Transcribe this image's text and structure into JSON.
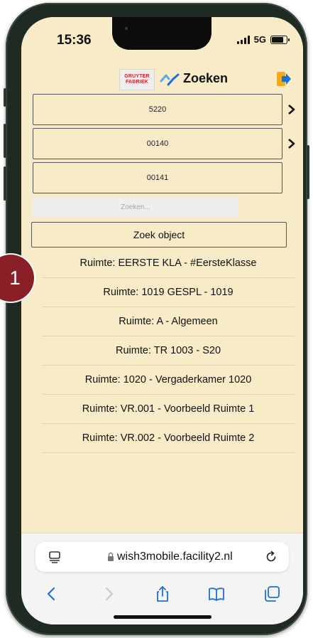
{
  "status_bar": {
    "time": "15:36",
    "network": "5G"
  },
  "header": {
    "brand_line1": "GRUYTER",
    "brand_line2": "FABRIEK",
    "title": "Zoeken"
  },
  "objects": [
    {
      "label": "5220",
      "has_children": true
    },
    {
      "label": "00140",
      "has_children": true
    },
    {
      "label": "00141",
      "has_children": false
    }
  ],
  "search": {
    "placeholder": "Zoeken...",
    "value": ""
  },
  "search_button": {
    "label": "Zoek object"
  },
  "results": [
    "Ruimte: EERSTE KLA - #EersteKlasse",
    "Ruimte: 1019 GESPL - 1019",
    "Ruimte: A - Algemeen",
    "Ruimte: TR 1003 - S20",
    "Ruimte: 1020 - Vergaderkamer 1020",
    "Ruimte: VR.001 - Voorbeeld Ruimte 1",
    "Ruimte: VR.002 - Voorbeeld Ruimte 2"
  ],
  "annotation": {
    "step": "1"
  },
  "browser": {
    "url": "wish3mobile.facility2.nl"
  },
  "colors": {
    "page_background": "#f8ecc8",
    "badge": "#8a1f27",
    "brand_red": "#d4222a",
    "logout_orange": "#f4a81d",
    "logout_blue": "#1b73d8",
    "link_blue": "#1e6fd9"
  }
}
